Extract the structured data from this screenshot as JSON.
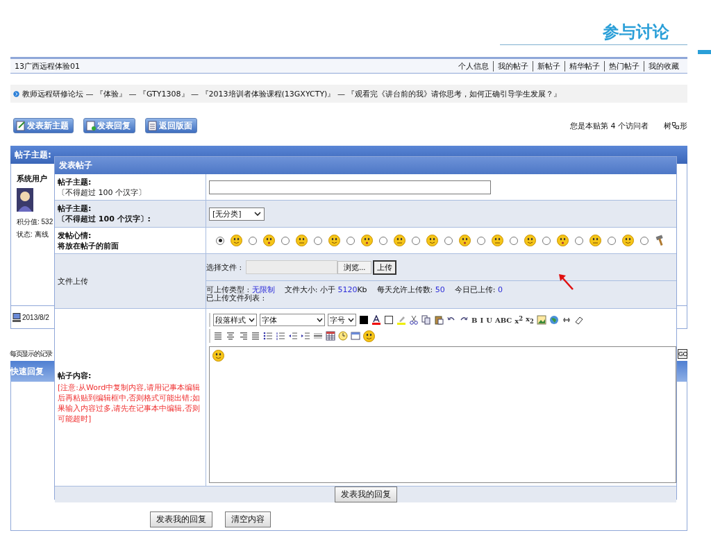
{
  "slide_title": "参与讨论",
  "header": {
    "site": "13广西远程体验01",
    "links": [
      "个人信息",
      "我的帖子",
      "新帖子",
      "精华帖子",
      "热门帖子",
      "我的收藏"
    ]
  },
  "breadcrumb": "教师远程研修论坛 — 『体验』 — 『GTY1308』 — 『2013培训者体验课程(13GXYCTY)』 — 『观看完《讲台前的我》请你思考，如何正确引导学生发展？』",
  "actions": [
    "发表新主题",
    "发表回复",
    "返回版面"
  ],
  "visitor": "您是本贴第 4 个访问者",
  "view_mode": [
    "树",
    "形"
  ],
  "post": {
    "subject_label": "帖子主题:",
    "author": "系统用户",
    "points": "积分值: 532",
    "status": "状态: 离线",
    "date": "2013/8/2"
  },
  "paging_label": "每页显示的记录",
  "go": "GO",
  "quick_reply": "快速回复",
  "bottom_buttons": [
    "发表我的回复",
    "清空内容"
  ],
  "dialog": {
    "title": "发表帖子",
    "subject": {
      "label": "帖子主题:",
      "hint": "〔不得超过 100 个汉字〕"
    },
    "category": {
      "label": "帖子主题:",
      "hint": "〔不得超过 100 个汉字〕:",
      "value": "[无分类]"
    },
    "mood": {
      "label": "发帖心情:",
      "hint": "将放在帖子的前面",
      "options": [
        {
          "kind": "face",
          "selected": true
        },
        {
          "kind": "face",
          "selected": false
        },
        {
          "kind": "face",
          "selected": false
        },
        {
          "kind": "face",
          "selected": false
        },
        {
          "kind": "face",
          "selected": false
        },
        {
          "kind": "face",
          "selected": false
        },
        {
          "kind": "face",
          "selected": false
        },
        {
          "kind": "face",
          "selected": false
        },
        {
          "kind": "face",
          "selected": false
        },
        {
          "kind": "face",
          "selected": false
        },
        {
          "kind": "face",
          "selected": false
        },
        {
          "kind": "face",
          "selected": false
        },
        {
          "kind": "face",
          "selected": false
        },
        {
          "kind": "hammer",
          "selected": false
        }
      ]
    },
    "upload": {
      "label": "文件上传",
      "choose": "选择文件 :",
      "browse": "浏览...",
      "upload": "上传",
      "info": [
        {
          "text": "可上传类型 :",
          "value": "无限制"
        },
        {
          "text": "文件大小: 小于",
          "value": "5120",
          "unit": "Kb"
        },
        {
          "text": "每天允许上传数:",
          "value": "50"
        },
        {
          "text": "今日已上传:",
          "value": "0"
        }
      ],
      "list_label": "已上传文件列表 :"
    },
    "content": {
      "label": "帖子内容:",
      "note": "[注意:从Word中复制内容,请用记事本编辑后再粘贴到编辑框中,否则格式可能出错;如果输入内容过多,请先在记事本中编辑,否则可能超时]",
      "selects": [
        "段落样式",
        "字体",
        "字号"
      ],
      "format_buttons": [
        "B",
        "I",
        "U",
        "ABC",
        "x$^{2}$",
        "x$_{2}$"
      ]
    },
    "submit": "发表我的回复"
  }
}
